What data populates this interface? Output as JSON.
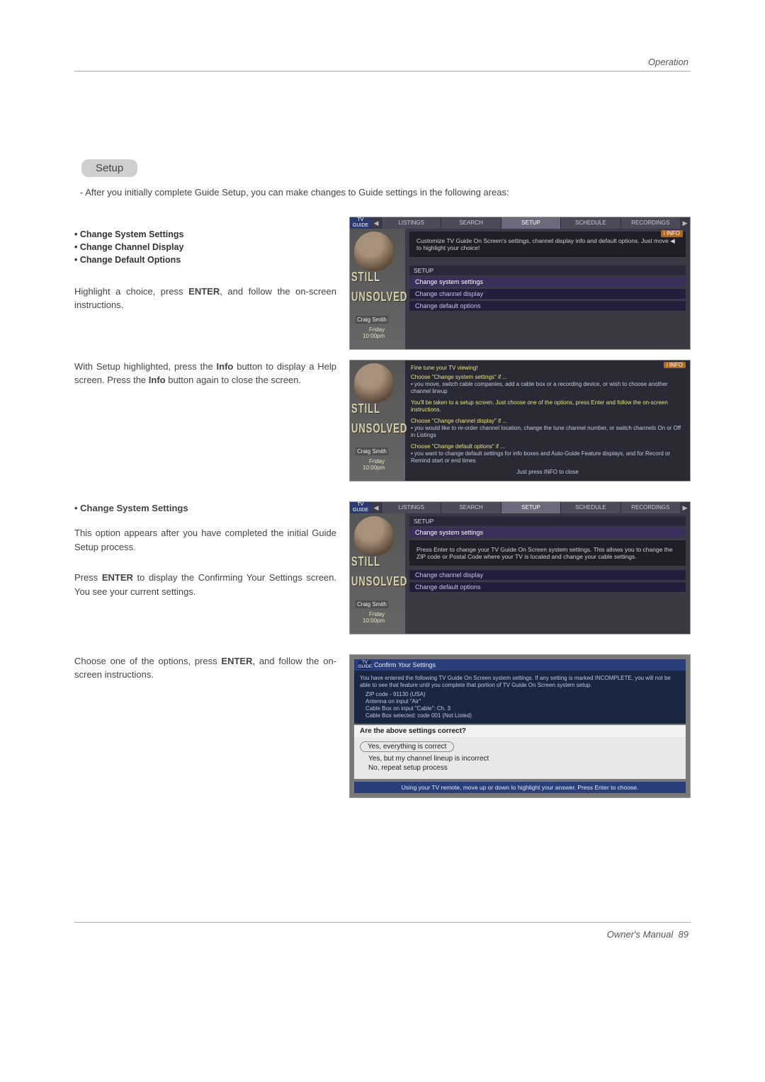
{
  "header": {
    "section": "Operation"
  },
  "pill": "Setup",
  "intro": "-  After you initially complete Guide Setup, you can make changes to Guide settings in the following areas:",
  "bullets": [
    "Change System Settings",
    "Change Channel Display",
    "Change Default Options"
  ],
  "para1_a": "Highlight a choice, press ",
  "para1_b": "ENTER",
  "para1_c": ", and follow the on-screen instructions.",
  "para2_a": "With Setup highlighted, press the ",
  "para2_b": "Info",
  "para2_c": " button to display a Help screen. Press the ",
  "para2_d": "Info",
  "para2_e": " button again to close the screen.",
  "section2_heading": "• Change System Settings",
  "section2_p1": "This option appears after you have completed the initial Guide Setup process.",
  "section2_p2_a": "Press ",
  "section2_p2_b": "ENTER",
  "section2_p2_c": " to display the Confirming Your Settings screen. You see your current settings.",
  "section2_p3_a": "Choose one of the options, press ",
  "section2_p3_b": "ENTER",
  "section2_p3_c": ", and follow the on-screen instructions.",
  "footer": {
    "label": "Owner's Manual",
    "page": "89"
  },
  "tv": {
    "tabs": [
      "LISTINGS",
      "SEARCH",
      "SETUP",
      "SCHEDULE",
      "RECORDINGS"
    ],
    "logo": "TV GUIDE",
    "info_badge": "i INFO",
    "pip": {
      "show1": "STILL",
      "show2": "UNSOLVED",
      "name": "Craig Smith",
      "day": "Friday",
      "time": "10:00pm"
    },
    "setup1": {
      "blurb": "Customize TV Guide On Screen's settings, channel display info and default options. Just move ◀ to highlight your choice!",
      "label": "SETUP",
      "opts": [
        "Change system settings",
        "Change channel display",
        "Change default options"
      ]
    },
    "help": {
      "title": "Fine tune your TV viewing!",
      "h1": "Choose \"Change system settings\" if ...",
      "b1": "• you move, switch cable companies, add a cable box or a recording device, or wish to choose another channel lineup",
      "mid": "You'll be taken to a setup screen. Just choose one of the options, press Enter and follow the on-screen instructions.",
      "h2": "Choose \"Change channel display\" if ...",
      "b2": "• you would like to re-order channel location, change the tune channel number, or switch channels On or Off in Listings",
      "h3": "Choose \"Change default options\" if ...",
      "b3": "• you want to change default settings for info boxes and Auto-Guide Feature displays, and for Record or Remind start or end times",
      "foot": "Just press INFO to close"
    },
    "setup2": {
      "label": "SETUP",
      "opt_hl": "Change system settings",
      "blurb": "Press Enter to change your TV Guide On Screen system settings. This allows you to change the ZIP code or Postal Code where your TV is located and change your cable settings.",
      "opt2": "Change channel display",
      "opt3": "Change default options"
    },
    "confirm": {
      "title": "Confirm Your Settings",
      "body": "You have entered the following TV Guide On Screen system settings. If any setting is marked INCOMPLETE, you will not be able to see that feature until you complete that portion of TV Guide On Screen system setup.",
      "lines": [
        "ZIP code - 91130 (USA)",
        "Antenna on input \"Air\"",
        "Cable Box on input \"Cable\": Ch. 3",
        "Cable Box selected: code 001 (Not Listed)"
      ],
      "question": "Are the above settings correct?",
      "choices": [
        "Yes, everything is correct",
        "Yes, but my channel lineup is incorrect",
        "No, repeat setup process"
      ],
      "foot": "Using your TV remote, move up or down to highlight your answer. Press Enter to choose."
    }
  }
}
